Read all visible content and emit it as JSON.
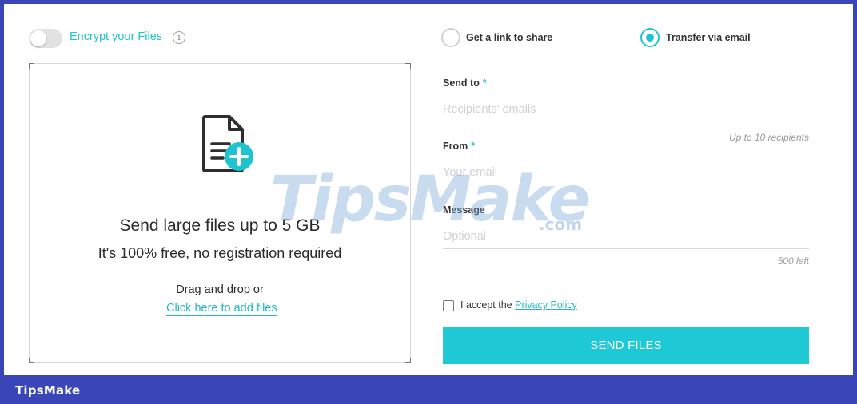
{
  "brand": {
    "footer_label": "TipsMake",
    "watermark_main": "TipsMake",
    "watermark_suffix": ".com"
  },
  "encrypt": {
    "label": "Encrypt your Files",
    "enabled": false,
    "info_icon": "info-icon"
  },
  "dropzone": {
    "icon": "file-add-icon",
    "title": "Send large files up to 5 GB",
    "subtitle": "It's 100% free, no registration required",
    "drag_text": "Drag and drop or",
    "add_link": "Click here to add files"
  },
  "delivery": {
    "options": [
      {
        "label": "Get a link to share",
        "selected": false
      },
      {
        "label": "Transfer via email",
        "selected": true
      }
    ]
  },
  "form": {
    "send_to": {
      "label": "Send to",
      "required_mark": "*",
      "placeholder": "Recipients' emails",
      "hint": "Up to 10 recipients"
    },
    "from": {
      "label": "From",
      "required_mark": "*",
      "placeholder": "Your email"
    },
    "message": {
      "label": "Message",
      "placeholder": "Optional",
      "hint": "500 left"
    },
    "accept": {
      "text": "I accept the",
      "link": "Privacy Policy",
      "checked": false
    },
    "submit_label": "SEND FILES"
  },
  "colors": {
    "accent": "#1fc3cf",
    "button": "#1ec8d4",
    "frame_border": "#3a45b8"
  }
}
